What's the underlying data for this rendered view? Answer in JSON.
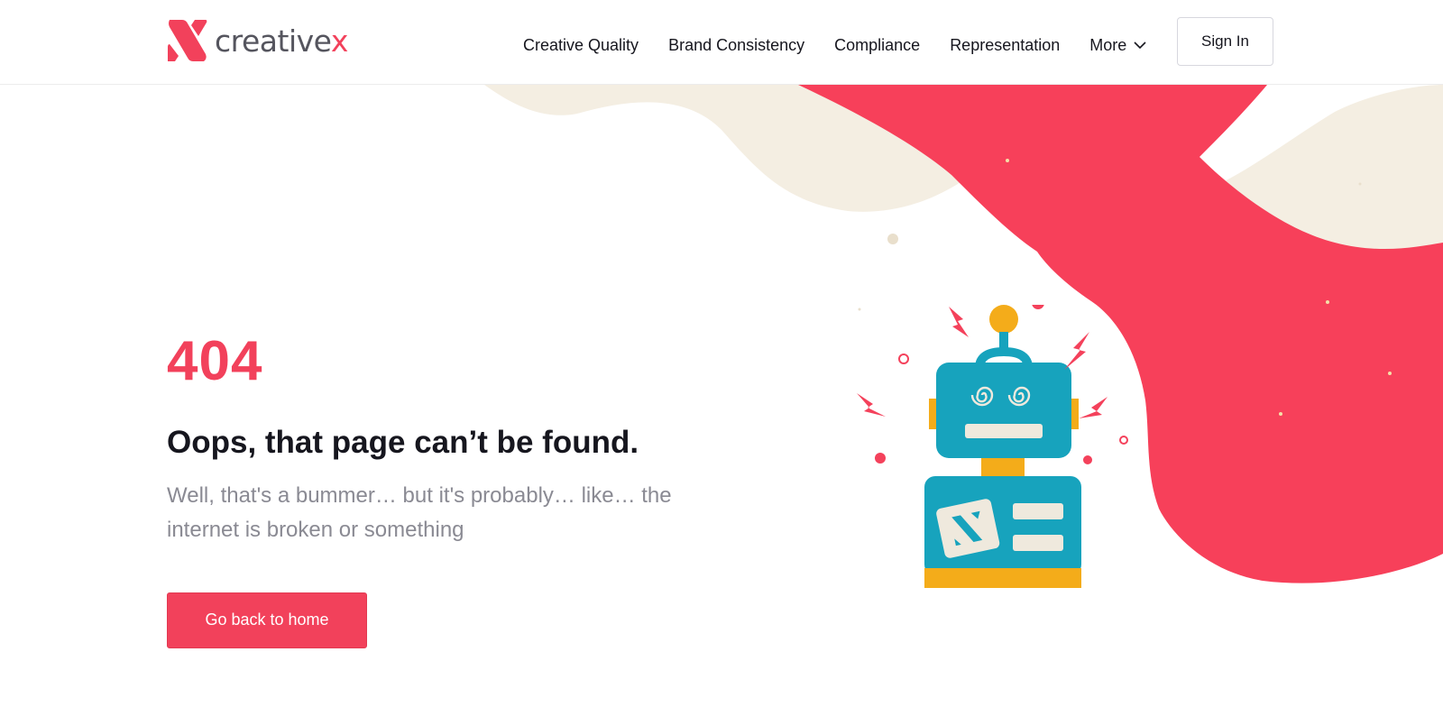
{
  "brand": {
    "name_prefix": "creative",
    "name_suffix": "x",
    "accent_color": "#f2415b",
    "text_color": "#55555e"
  },
  "nav": {
    "items": [
      {
        "label": "Creative Quality"
      },
      {
        "label": "Brand Consistency"
      },
      {
        "label": "Compliance"
      },
      {
        "label": "Representation"
      },
      {
        "label": "More"
      }
    ],
    "sign_in_label": "Sign In"
  },
  "error": {
    "code": "404",
    "title": "Oops, that page can’t be found.",
    "description": "Well, that's a bummer… but it's probably… like… the internet is broken or something",
    "home_button_label": "Go back to home"
  },
  "icons": {
    "logo": "creativex-logo-icon",
    "more_chevron": "chevron-down-icon",
    "illustration": "broken-robot-illustration"
  },
  "colors": {
    "coral": "#f7405a",
    "cream": "#f4eee2",
    "robot_teal": "#17a3bd",
    "robot_yellow": "#f4ac1a",
    "robot_panel": "#efe9dd"
  }
}
